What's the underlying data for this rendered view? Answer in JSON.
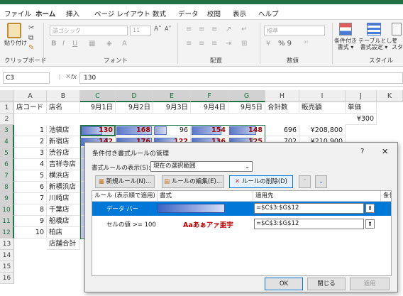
{
  "menu": [
    "ファイル",
    "ホーム",
    "挿入",
    "ページ レイアウト",
    "数式",
    "データ",
    "校閲",
    "表示",
    "ヘルプ"
  ],
  "ribbon": {
    "paste": "貼り付け",
    "font_name": "游ゴシック",
    "font_size": "11",
    "number_format": "標準",
    "number_symbols": "% 9",
    "cond_format_1": "条件付き",
    "cond_format_2": "書式 ▾",
    "table_1": "テーブルとして",
    "table_2": "書式設定 ▾",
    "cellstyle_1": "セ",
    "cellstyle_2": "スタ",
    "groups": {
      "clipboard": "クリップボード",
      "font": "フォント",
      "alignment": "配置",
      "number": "数値",
      "style": "スタイル"
    }
  },
  "formula_bar": {
    "name_box": "C3",
    "fx": "fx",
    "value": "130"
  },
  "columns": [
    "A",
    "B",
    "C",
    "D",
    "E",
    "F",
    "G",
    "H",
    "I",
    "J",
    "K"
  ],
  "rows": [
    "1",
    "2",
    "3",
    "4",
    "5",
    "6",
    "7",
    "8",
    "9",
    "10",
    "11",
    "12",
    "13",
    "14",
    "15",
    "16"
  ],
  "sheet": {
    "headers": [
      "店コード",
      "店名",
      "9月1日",
      "9月2日",
      "9月3日",
      "9月4日",
      "9月5日",
      "合計数",
      "販売額",
      "単価"
    ],
    "unit_price": "¥300",
    "row3": {
      "code": "1",
      "name": "池袋店",
      "d1": "130",
      "d2": "168",
      "d3": "96",
      "d4": "154",
      "d5": "148",
      "total": "696",
      "sales": "¥208,800"
    },
    "row4": {
      "code": "2",
      "name": "新宿店",
      "d1": "142",
      "d2": "176",
      "d3": "122",
      "d4": "136",
      "d5": "125",
      "total": "702",
      "sales": "¥210,900"
    },
    "stores": [
      {
        "code": "3",
        "name": "渋谷店"
      },
      {
        "code": "4",
        "name": "吉祥寺店"
      },
      {
        "code": "5",
        "name": "横浜店"
      },
      {
        "code": "6",
        "name": "新横浜店"
      },
      {
        "code": "7",
        "name": "川崎店"
      },
      {
        "code": "8",
        "name": "千葉店"
      },
      {
        "code": "9",
        "name": "船橋店"
      },
      {
        "code": "10",
        "name": "柏店"
      }
    ],
    "total_label": "店舗合計"
  },
  "dialog": {
    "title": "条件付き書式ルールの管理",
    "help": "?",
    "close": "✕",
    "scope_label": "書式ルールの表示(S):",
    "scope_value": "現在の選択範囲",
    "new_rule": "新規ルール(N)...",
    "edit_rule": "ルールの編集(E)...",
    "delete_rule": "ルールの削除(D)",
    "col_rule": "ルール (表示順で適用)",
    "col_format": "書式",
    "col_applies": "適用先",
    "col_stop": "条件を満たす場合は停止",
    "rule1_name": "データ バー",
    "rule1_range": "=$C$3:$G$12",
    "rule2_name": "セルの値 >= 100",
    "rule2_preview": "Aaあぁアァ亜宇",
    "rule2_range": "=$C$3:$G$12",
    "ok": "OK",
    "close_btn": "閉じる",
    "apply": "適用"
  },
  "colors": {
    "accent": "#217346",
    "selection": "#0078d7",
    "highlight_text": "#9c0006",
    "databar": "#5a76c7"
  }
}
